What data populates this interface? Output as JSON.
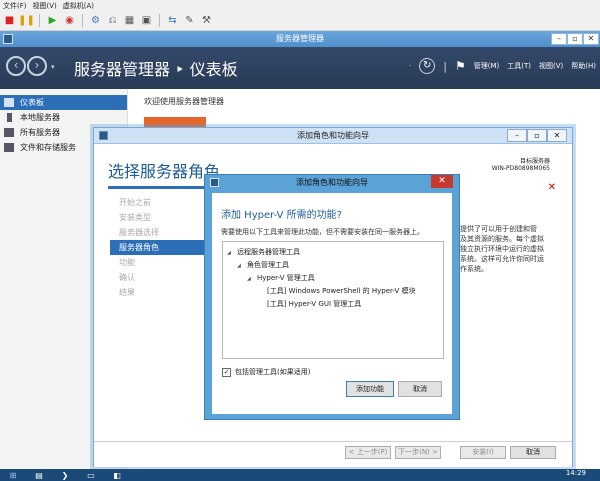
{
  "host_menu": {
    "items": [
      "文件(F)",
      "视图(V)",
      "虚拟机(A)"
    ]
  },
  "window": {
    "title": "服务器管理器"
  },
  "header": {
    "breadcrumb": "服务器管理器 ‣ 仪表板",
    "menu": [
      "管理(M)",
      "工具(T)",
      "视图(V)",
      "帮助(H)"
    ]
  },
  "sidebar": {
    "items": [
      {
        "label": "仪表板",
        "active": true
      },
      {
        "label": "本地服务器",
        "active": false
      },
      {
        "label": "所有服务器",
        "active": false
      },
      {
        "label": "文件和存储服务",
        "active": false
      }
    ]
  },
  "main": {
    "welcome": "欢迎使用服务器管理器"
  },
  "wizard": {
    "title": "添加角色和功能向导",
    "heading": "选择服务器角色",
    "dest_label": "目标服务器",
    "dest_server": "WIN-PD80898M065",
    "steps": [
      "开始之前",
      "安装类型",
      "服务器选择",
      "服务器角色",
      "功能",
      "确认",
      "结果"
    ],
    "description": [
      "提供了可以用于创建和管",
      "及其资源的服务。每个虚拟",
      "独立执行环境中运行的虚拟",
      "系统。这样可允许你同时运",
      "作系统。"
    ],
    "buttons": {
      "prev": "< 上一步(P)",
      "next": "下一步(N) >",
      "install": "安装(I)",
      "cancel": "取消"
    }
  },
  "dialog": {
    "title": "添加角色和功能向导",
    "heading": "添加 Hyper-V 所需的功能?",
    "note": "需要使用以下工具来管理此功能，但不需要安装在同一服务器上。",
    "tree": [
      "远程服务器管理工具",
      "角色管理工具",
      "Hyper-V 管理工具",
      "[工具] Windows PowerShell 的 Hyper-V 模块",
      "[工具] Hyper-V GUI 管理工具"
    ],
    "include_tools_label": "包括管理工具(如果适用)",
    "include_tools_checked": true,
    "add_button": "添加功能",
    "cancel_button": "取消"
  },
  "taskbar": {
    "clock": "14:29"
  }
}
